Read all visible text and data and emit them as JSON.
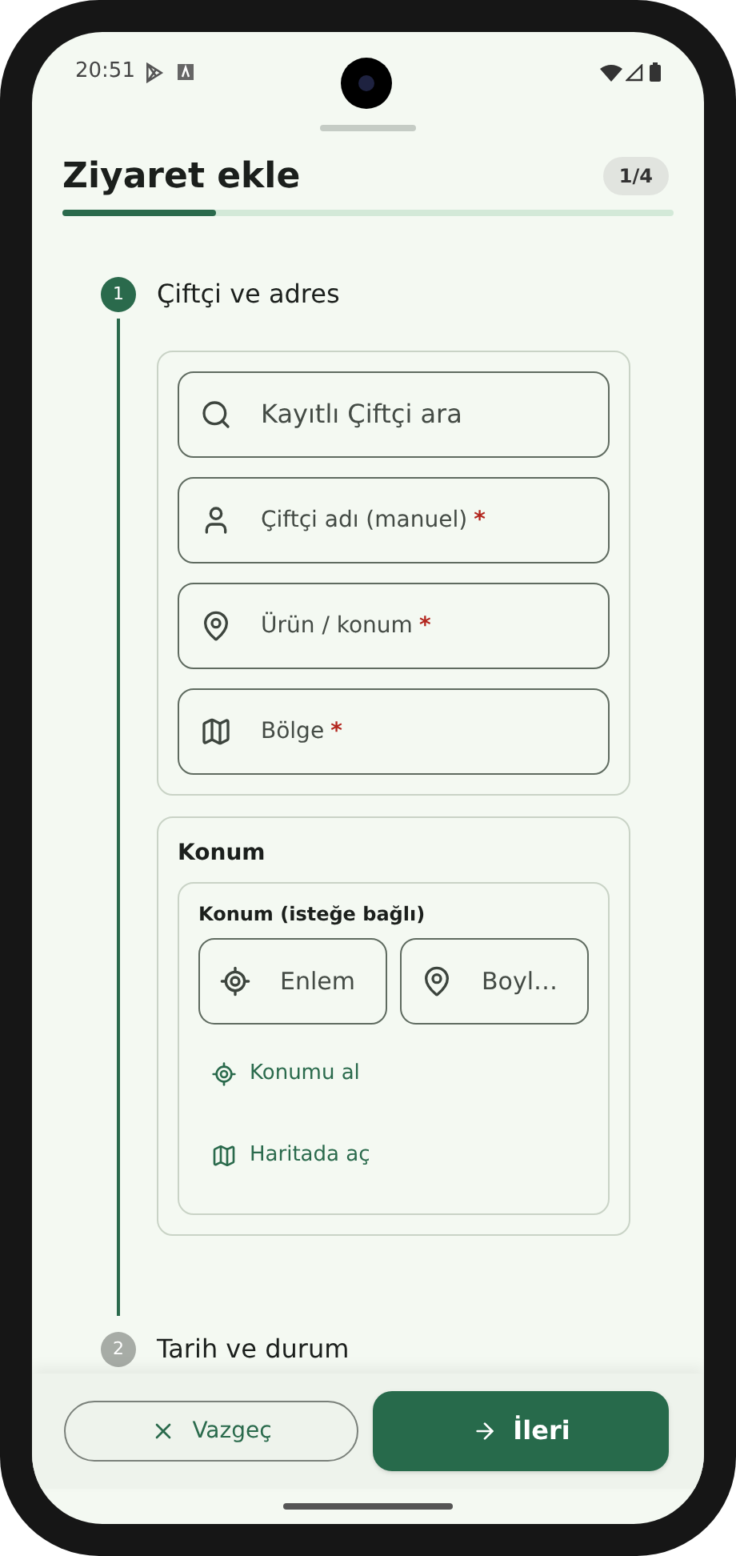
{
  "status_bar": {
    "time": "20:51"
  },
  "header": {
    "title": "Ziyaret ekle",
    "step_badge": "1/4",
    "progress": {
      "level": 0.25
    }
  },
  "steps": [
    {
      "number": "1",
      "label": "Çiftçi ve adres",
      "active": true
    },
    {
      "number": "2",
      "label": "Tarih ve durum",
      "active": false
    }
  ],
  "farmer_fields": [
    {
      "kind": "search",
      "placeholder": "Kayıtlı Çiftçi ara"
    },
    {
      "kind": "person",
      "placeholder": "Çiftçi adı (manuel)",
      "required_mark": "*"
    },
    {
      "kind": "pin",
      "placeholder": "Ürün / konum",
      "required_mark": "*"
    },
    {
      "kind": "map",
      "placeholder": "Bölge",
      "required_mark": "*"
    }
  ],
  "location": {
    "title": "Konum",
    "subtitle": "Konum (isteğe bağlı)",
    "fields": [
      {
        "kind": "target",
        "placeholder": "Enlem"
      },
      {
        "kind": "pin",
        "placeholder": "Boyl…"
      }
    ],
    "actions": [
      {
        "kind": "target",
        "label": "Konumu al"
      },
      {
        "kind": "map",
        "label": "Haritada aç"
      }
    ]
  },
  "buttons": [
    {
      "kind": "cancel",
      "label": "Vazgeç"
    },
    {
      "kind": "next",
      "label": "İleri"
    }
  ]
}
